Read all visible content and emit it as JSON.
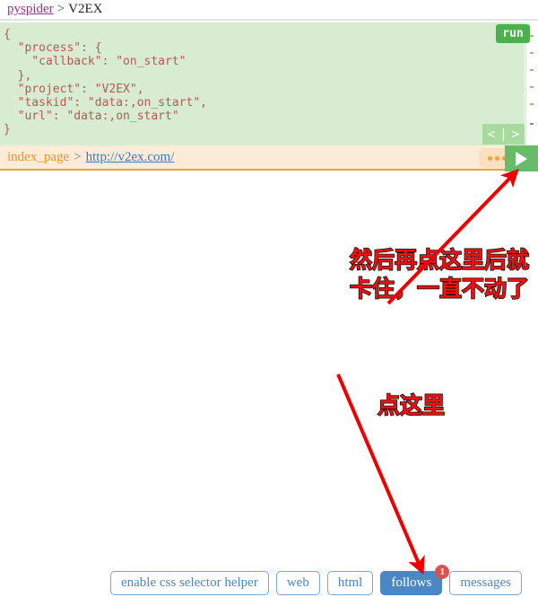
{
  "header": {
    "project_link": "pyspider",
    "separator": ">",
    "project_name": "V2EX"
  },
  "editor": {
    "code": "{\n  \"process\": {\n    \"callback\": \"on_start\"\n  },\n  \"project\": \"V2EX\",\n  \"taskid\": \"data:,on_start\",\n  \"url\": \"data:,on_start\"\n}",
    "run_label": "run",
    "nav_prev": "<",
    "nav_divider": "|",
    "nav_next": ">",
    "colors": {
      "background": "#d8ecd2",
      "text": "#b35a54",
      "run_button": "#4cb14c"
    }
  },
  "taskbar": {
    "callback_name": "index_page",
    "separator": ">",
    "task_url": "http://v2ex.com/",
    "menu_icon": "ellipsis-icon",
    "run_icon": "play-icon",
    "colors": {
      "background": "#fcebd7",
      "border": "#e8a33d",
      "callback_text": "#e8962e",
      "url_link": "#3b78c2"
    }
  },
  "annotations": [
    {
      "id": "anno-1",
      "line1": "然后再点这里后就",
      "line2": "卡住，一直不动了",
      "color": "#ee1111",
      "outline": "#111111",
      "arrow_target": "play-button"
    },
    {
      "id": "anno-2",
      "line1": "点这里",
      "color": "#ee1111",
      "outline": "#111111",
      "arrow_target": "follows-button"
    }
  ],
  "bottombar": {
    "buttons": [
      {
        "label": "enable css selector helper",
        "active": false,
        "badge": null
      },
      {
        "label": "web",
        "active": false,
        "badge": null
      },
      {
        "label": "html",
        "active": false,
        "badge": null
      },
      {
        "label": "follows",
        "active": true,
        "badge": "1"
      },
      {
        "label": "messages",
        "active": false,
        "badge": null
      }
    ],
    "colors": {
      "outline": "#7ba7d7",
      "text": "#4a87c4",
      "active_bg": "#4b87c2",
      "badge_bg": "#d9534f"
    }
  }
}
